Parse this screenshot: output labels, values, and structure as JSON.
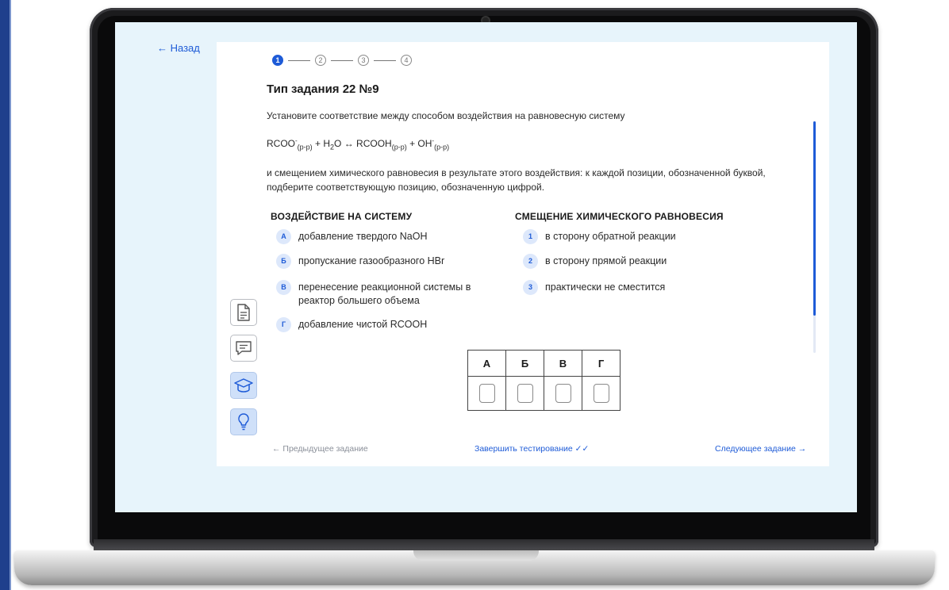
{
  "nav": {
    "back_label": "← Назад"
  },
  "stepper": {
    "steps": [
      "1",
      "2",
      "3",
      "4"
    ],
    "active_index": 0
  },
  "task": {
    "title": "Тип задания 22 №9",
    "intro": "Установите соответствие между способом воздействия на равновесную систему",
    "formula": {
      "r1": "RCOO",
      "r1_sup": "-",
      "r1_sub": "(р-р)",
      "plus1": " + H",
      "h2o_sub": "2",
      "h2o_rest": "O ↔ RCOOH",
      "p1_sub": "(р-р)",
      "plus2": " + OH",
      "p2_sup": "-",
      "p2_sub": "(р-р)"
    },
    "instruction": "и смещением химического равновесия в результате этого воздействия: к каждой позиции, обозначенной буквой, подберите соответствующую позицию, обозначенную цифрой."
  },
  "left_column": {
    "header": "ВОЗДЕЙСТВИЕ НА СИСТЕМУ",
    "items": [
      {
        "letter": "А",
        "text": "добавление твердого NaOH"
      },
      {
        "letter": "Б",
        "text": "пропускание газообразного HBr"
      },
      {
        "letter": "В",
        "text": "перенесение реакционной системы в реактор большего объема"
      },
      {
        "letter": "Г",
        "text": "добавление чистой RCOOH"
      }
    ]
  },
  "right_column": {
    "header": "СМЕЩЕНИЕ ХИМИЧЕСКОГО РАВНОВЕСИЯ",
    "items": [
      {
        "num": "1",
        "text": "в сторону обратной реакции"
      },
      {
        "num": "2",
        "text": "в сторону прямой реакции"
      },
      {
        "num": "3",
        "text": "практически не сместится"
      }
    ]
  },
  "answer_table": {
    "headers": [
      "А",
      "Б",
      "В",
      "Г"
    ],
    "values": [
      "",
      "",
      "",
      ""
    ]
  },
  "footer": {
    "prev_label": "← Предыдущее задание",
    "finish_label": "Завершить тестирование ✓✓",
    "next_label": "Следующее задание →"
  },
  "tools": [
    "document-icon",
    "comment-icon",
    "graduation-cap-icon",
    "lightbulb-icon"
  ],
  "colors": {
    "accent": "#1e5bd7",
    "screen_bg": "#e7f4fb",
    "badge_bg": "#dde8fb",
    "tool_active_bg": "#cfe0f9"
  }
}
